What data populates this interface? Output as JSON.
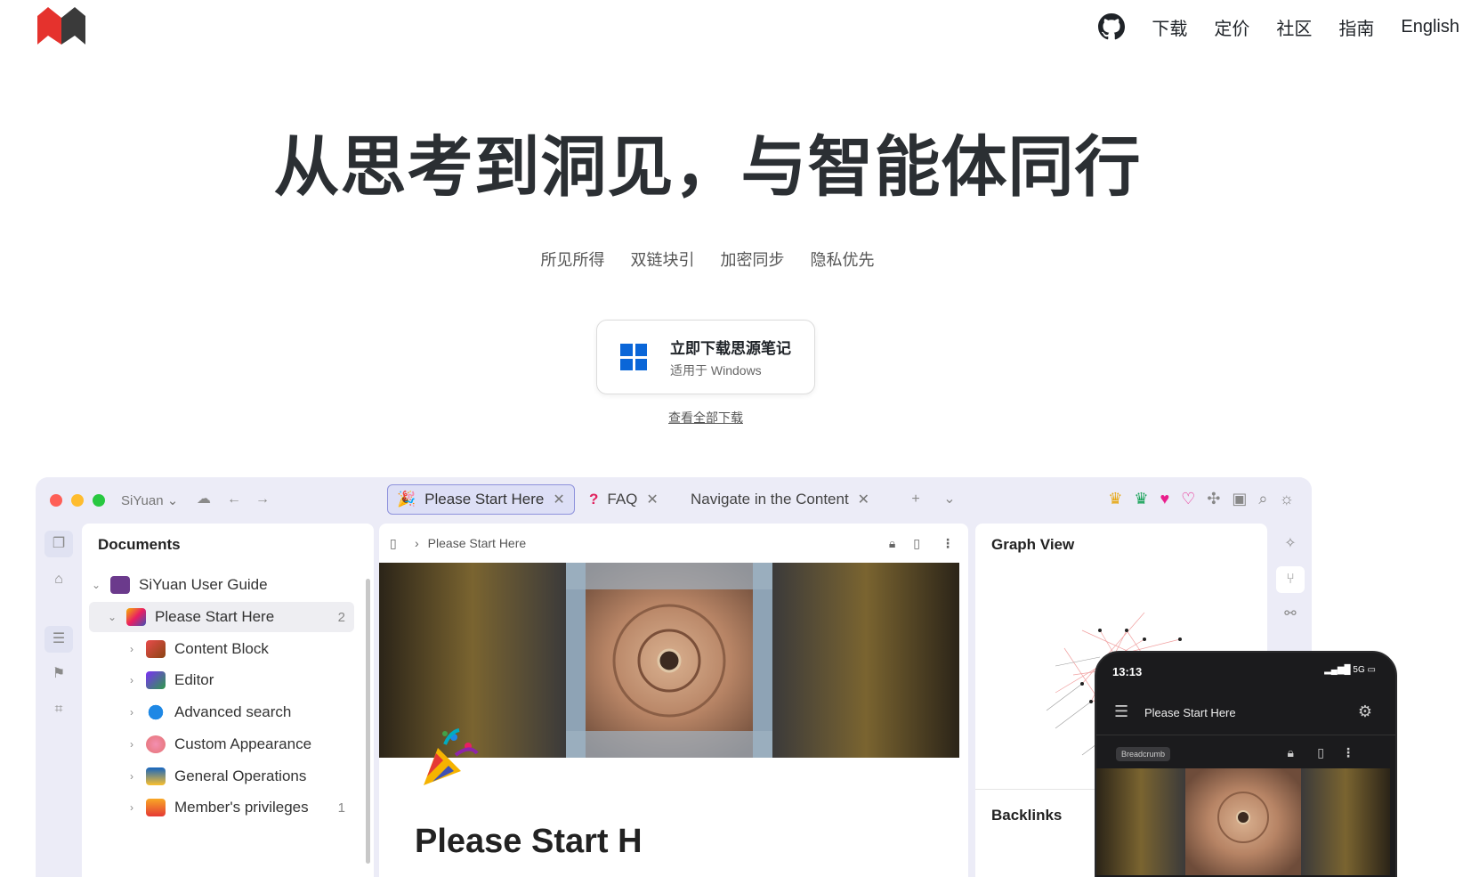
{
  "nav": {
    "links": [
      "下载",
      "定价",
      "社区",
      "指南",
      "English"
    ]
  },
  "hero": {
    "title": "从思考到洞见，与智能体同行",
    "features": [
      "所见所得",
      "双链块引",
      "加密同步",
      "隐私优先"
    ],
    "download_label": "立即下载思源笔记",
    "download_sub": "适用于 Windows",
    "all_downloads": "查看全部下载"
  },
  "app": {
    "workspace": "SiYuan",
    "tabs": [
      {
        "label": "Please Start Here",
        "active": true
      },
      {
        "label": "FAQ",
        "active": false
      },
      {
        "label": "Navigate in the Content",
        "active": false
      }
    ],
    "doc_panel": {
      "title": "Documents",
      "tree": [
        {
          "label": "SiYuan User Guide",
          "count": ""
        },
        {
          "label": "Please Start Here",
          "count": "2"
        },
        {
          "label": "Content Block",
          "count": ""
        },
        {
          "label": "Editor",
          "count": ""
        },
        {
          "label": "Advanced search",
          "count": ""
        },
        {
          "label": "Custom Appearance",
          "count": ""
        },
        {
          "label": "General Operations",
          "count": ""
        },
        {
          "label": "Member's privileges",
          "count": "1"
        }
      ]
    },
    "editor": {
      "breadcrumb": "Please Start Here",
      "heading": "Please Start H"
    },
    "graph_panel": {
      "title": "Graph View",
      "backlinks": "Backlinks"
    }
  },
  "phone": {
    "time": "13:13",
    "network": "5G",
    "title": "Please Start Here",
    "breadcrumb": "Breadcrumb"
  },
  "colors": {
    "brand_red": "#e5322d",
    "accent": "#8e92dc",
    "windows_blue": "#0a66d8"
  }
}
